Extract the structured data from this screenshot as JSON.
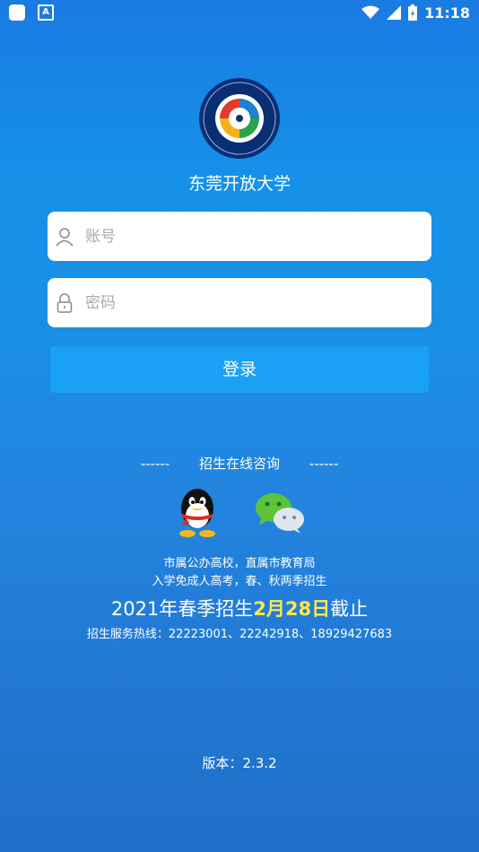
{
  "status_bar": {
    "time": "11:18"
  },
  "header": {
    "school_name": "东莞开放大学"
  },
  "login": {
    "username_placeholder": "账号",
    "password_placeholder": "密码",
    "login_label": "登录"
  },
  "consult": {
    "left_dash": "------",
    "title": "招生在线咨询",
    "right_dash": "------"
  },
  "info": {
    "line1": "市属公办高校，直属市教育局",
    "line2": "入学免成人高考，春、秋两季招生",
    "deadline_prefix": "2021年春季招生",
    "deadline_date": "2月28日",
    "deadline_suffix": "截止",
    "hotline": "招生服务热线：22223001、22242918、18929427683"
  },
  "footer": {
    "version": "版本：2.3.2"
  },
  "colors": {
    "highlight": "#ffe84a",
    "button": "#1aa0f5"
  }
}
